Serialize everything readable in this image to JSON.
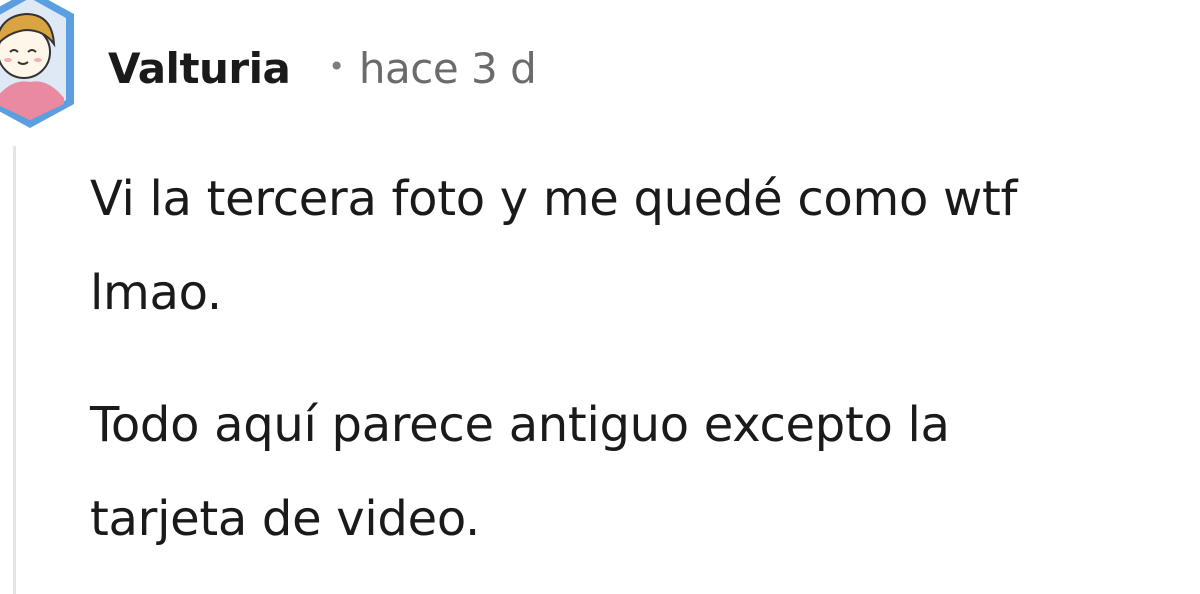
{
  "comment": {
    "author": "Valturia",
    "separator": "•",
    "timestamp": "hace 3 d",
    "paragraphs": [
      "Vi la tercera foto y me quedé como wtf\nlmao.",
      "Todo aquí parece antiguo excepto la\ntarjeta de video."
    ],
    "avatar_icon": "cartoon-avatar-icon"
  },
  "colors": {
    "avatar_frame": "#5b9fe0",
    "avatar_hair": "#d9a441",
    "avatar_shirt": "#e98aa0",
    "thread_line": "#e5e5e5",
    "text": "#1a1a1a",
    "meta": "#6b6b6b"
  }
}
